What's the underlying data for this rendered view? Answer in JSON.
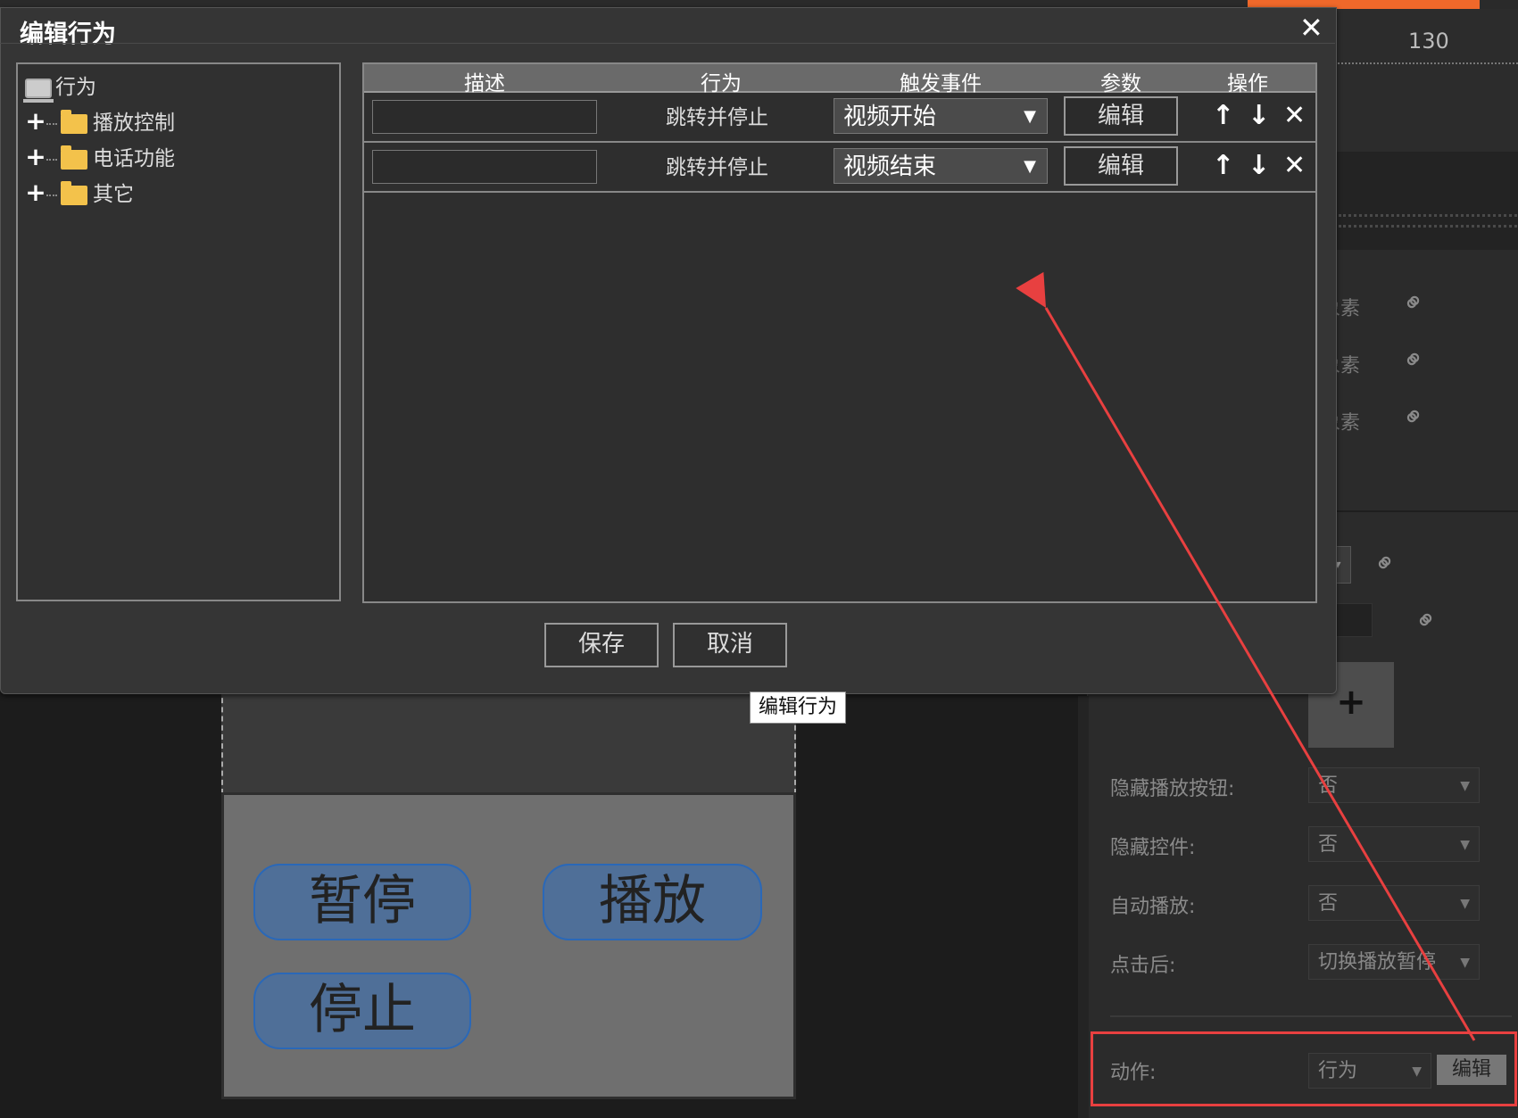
{
  "timeline": {
    "label": "130"
  },
  "right_panel": {
    "link_rows": [
      "象素",
      "象素",
      "象素"
    ],
    "properties": [
      {
        "label": "隐藏播放按钮:",
        "value": "否"
      },
      {
        "label": "隐藏控件:",
        "value": "否"
      },
      {
        "label": "自动播放:",
        "value": "否"
      },
      {
        "label": "点击后:",
        "value": "切换播放暂停"
      }
    ],
    "action": {
      "label": "动作:",
      "value": "行为",
      "edit_label": "编辑"
    },
    "plus_label": "+"
  },
  "canvas": {
    "buttons": [
      "暂停",
      "播放",
      "停止"
    ]
  },
  "dialog": {
    "title": "编辑行为",
    "close": "✕",
    "tree": {
      "root": "行为",
      "items": [
        "播放控制",
        "电话功能",
        "其它"
      ]
    },
    "grid": {
      "headers": [
        "描述",
        "行为",
        "触发事件",
        "参数",
        "操作"
      ],
      "rows": [
        {
          "description": "",
          "behavior": "跳转并停止",
          "event": "视频开始",
          "param": "编辑"
        },
        {
          "description": "",
          "behavior": "跳转并停止",
          "event": "视频结束",
          "param": "编辑"
        }
      ],
      "ops": {
        "up": "↑",
        "down": "↓",
        "delete": "✕"
      }
    },
    "save_label": "保存",
    "cancel_label": "取消"
  },
  "tooltip": "编辑行为",
  "colors": {
    "accent_orange": "#f0682a",
    "annotation_red": "#e84040",
    "pill_blue": "#4f6f98"
  }
}
